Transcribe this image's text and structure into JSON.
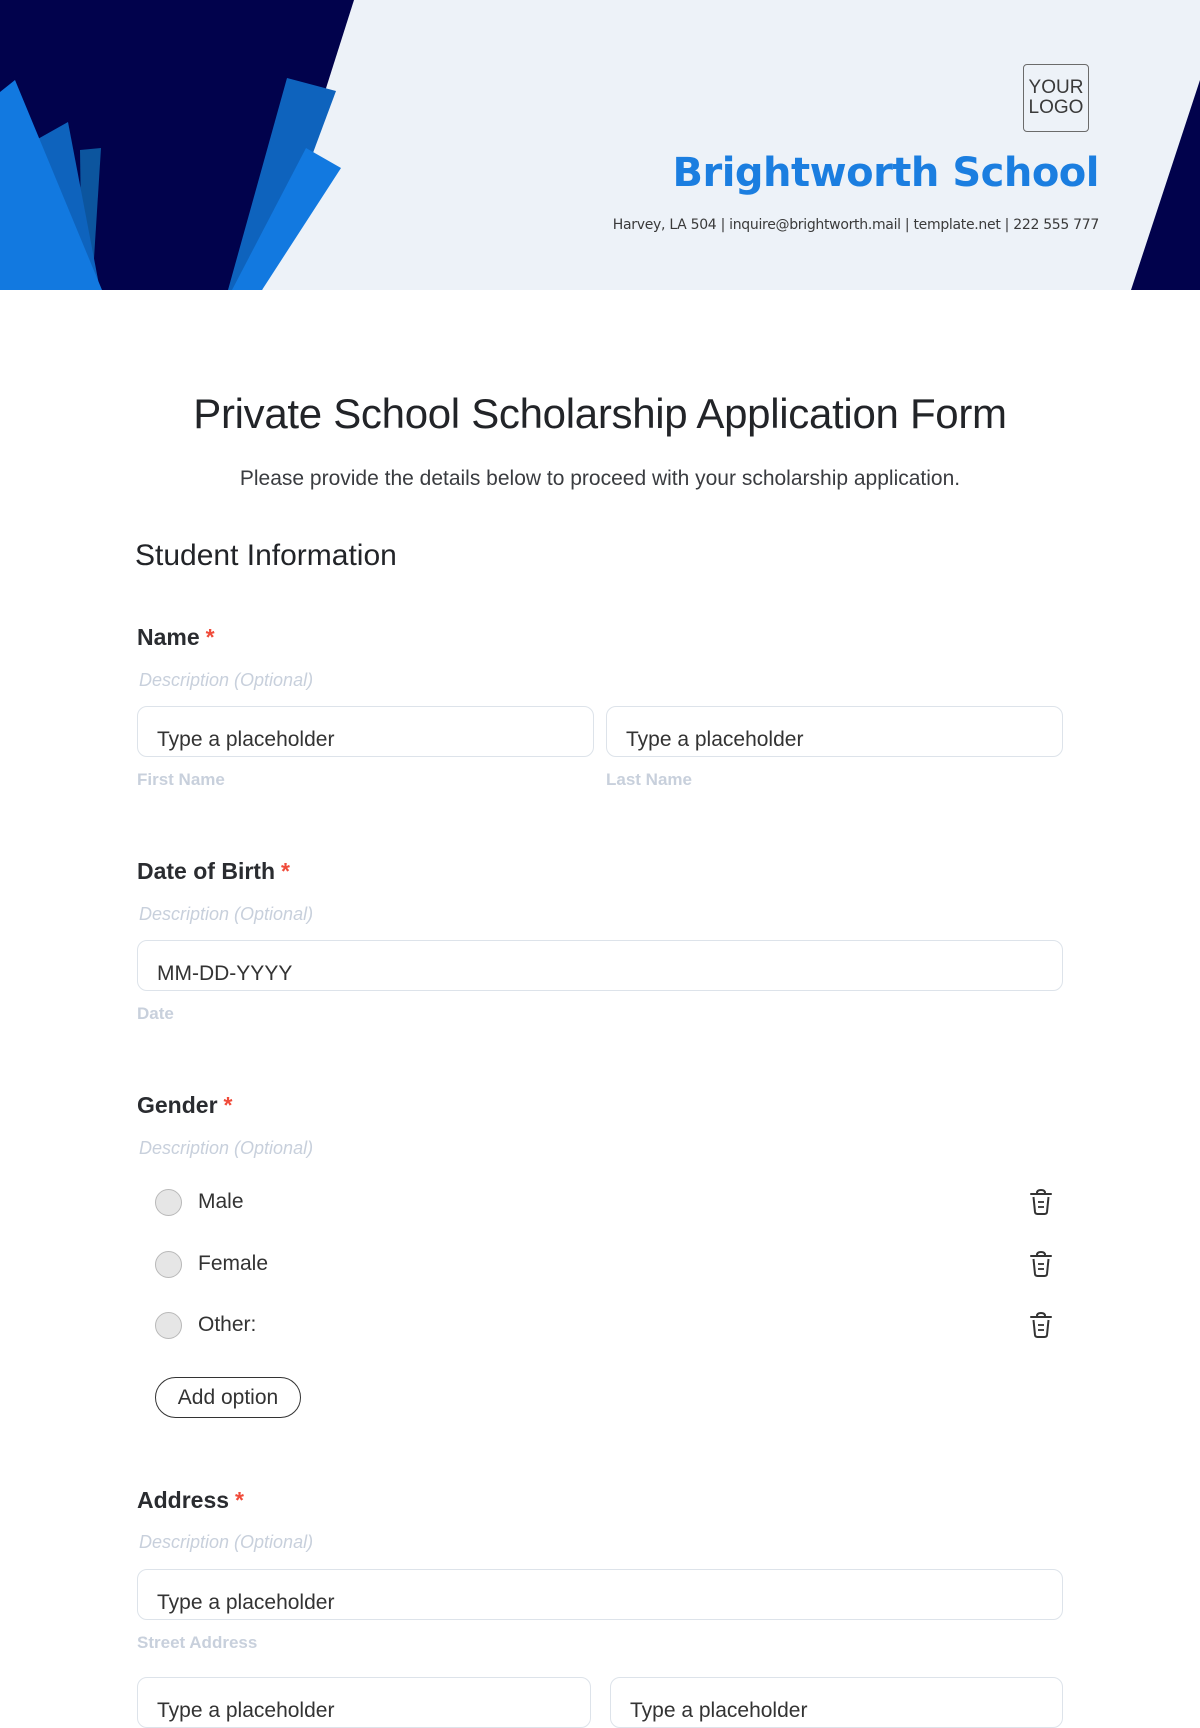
{
  "header": {
    "logo_line1": "YOUR",
    "logo_line2": "LOGO",
    "school_name": "Brightworth School",
    "contact": "Harvey, LA 504 | inquire@brightworth.mail | template.net | 222 555 777",
    "colors": {
      "navy": "#01024c",
      "blue": "#1279e0",
      "mid_blue": "#0e63bd",
      "dark_blue": "#0c559e",
      "bg": "#edf2f8",
      "brand": "#1b7ee0"
    }
  },
  "form": {
    "title": "Private School Scholarship Application Form",
    "subtitle": "Please provide the details below to proceed with your scholarship application.",
    "section_title": "Student Information",
    "required_marker": "*",
    "fields": [
      {
        "label": "Name",
        "description": "Description (Optional)",
        "inputs": [
          {
            "placeholder": "Type a placeholder",
            "sublabel": "First Name"
          },
          {
            "placeholder": "Type a placeholder",
            "sublabel": "Last Name"
          }
        ]
      },
      {
        "label": "Date of Birth",
        "description": "Description (Optional)",
        "inputs": [
          {
            "placeholder": "MM-DD-YYYY",
            "sublabel": "Date"
          }
        ]
      },
      {
        "label": "Gender",
        "description": "Description (Optional)",
        "options": [
          "Male",
          "Female",
          "Other:"
        ],
        "add_option_label": "Add option"
      },
      {
        "label": "Address",
        "description": "Description (Optional)",
        "inputs": [
          {
            "placeholder": "Type a placeholder",
            "sublabel": "Street Address"
          },
          {
            "placeholder": "Type a placeholder",
            "sublabel": ""
          },
          {
            "placeholder": "Type a placeholder",
            "sublabel": ""
          }
        ]
      }
    ]
  }
}
